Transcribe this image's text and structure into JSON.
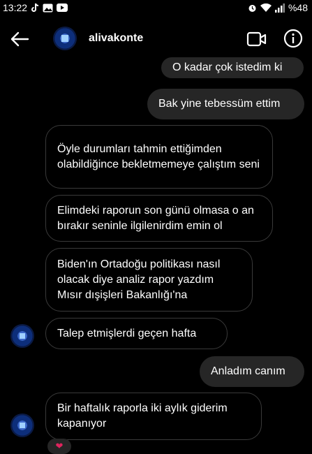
{
  "status_bar": {
    "time": "13:22",
    "battery": "%48"
  },
  "header": {
    "contact_name": "alivakonte"
  },
  "messages": [
    {
      "side": "out",
      "text": "O kadar çok istedim ki"
    },
    {
      "side": "out",
      "text": "Bak yine tebessüm ettim"
    },
    {
      "side": "in",
      "text": "Öyle durumları tahmin ettiğimden olabildiğince bekletmemeye çalıştım seni"
    },
    {
      "side": "in",
      "text": "Elimdeki raporun son günü olmasa o an bırakır seninle ilgilenirdim emin ol"
    },
    {
      "side": "in",
      "text": "Biden'ın Ortadoğu politikası nasıl olacak diye analiz rapor yazdım Mısır dışişleri Bakanlığı'na"
    },
    {
      "side": "in",
      "text": "Talep etmişlerdi geçen hafta"
    },
    {
      "side": "out",
      "text": "Anladım canım"
    },
    {
      "side": "in",
      "text": "Bir haftalık raporla iki aylık giderim kapanıyor"
    }
  ],
  "reaction": {
    "icon": "heart-icon",
    "glyph": "❤"
  }
}
